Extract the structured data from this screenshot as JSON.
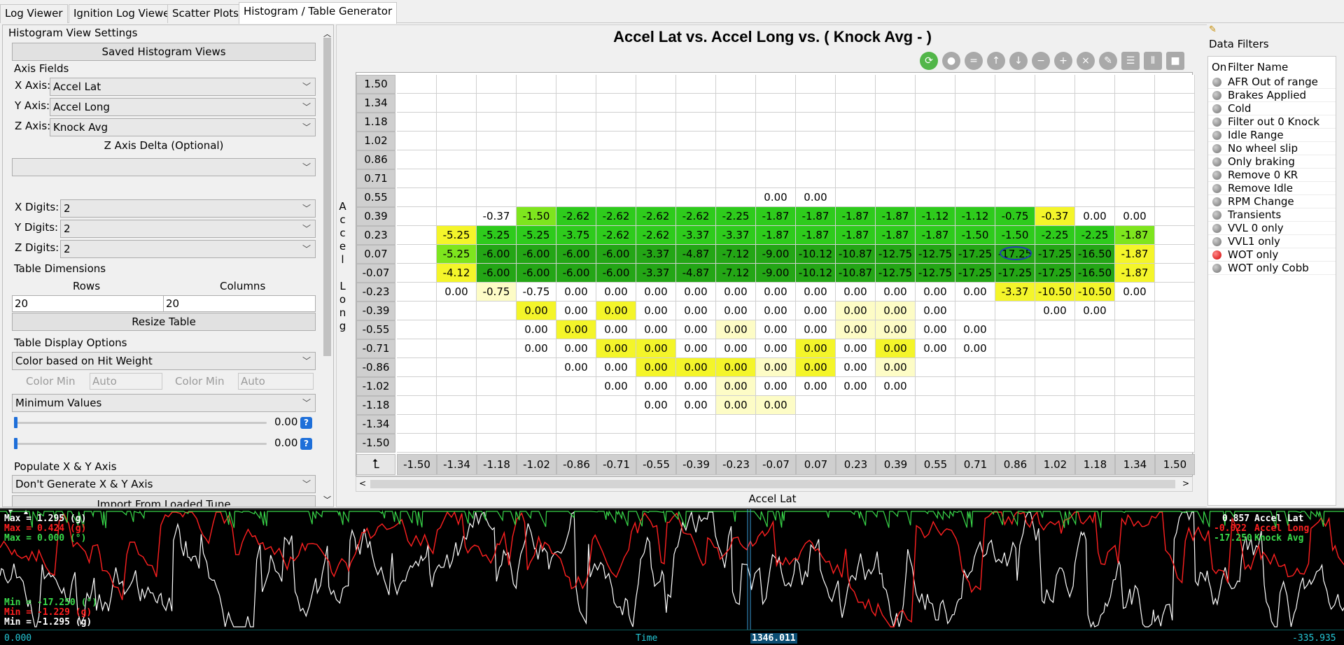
{
  "tabs": [
    {
      "label": "Log Viewer",
      "active": false
    },
    {
      "label": "Ignition Log Viewer",
      "active": false
    },
    {
      "label": "Scatter Plots",
      "active": false
    },
    {
      "label": "Histogram / Table Generator",
      "active": true
    }
  ],
  "settings": {
    "panel_title": "Histogram View Settings",
    "saved_views_button": "Saved Histogram Views",
    "axis_fields_title": "Axis Fields",
    "x_axis_label": "X Axis:",
    "x_axis_value": "Accel Lat",
    "y_axis_label": "Y Axis:",
    "y_axis_value": "Accel Long",
    "z_axis_label": "Z Axis:",
    "z_axis_value": "Knock Avg",
    "z_delta_label": "Z Axis Delta (Optional)",
    "z_delta_value": "",
    "x_digits_label": "X Digits:",
    "x_digits_value": "2",
    "y_digits_label": "Y Digits:",
    "y_digits_value": "2",
    "z_digits_label": "Z Digits:",
    "z_digits_value": "2",
    "table_dims_title": "Table Dimensions",
    "rows_label": "Rows",
    "rows_value": "20",
    "columns_label": "Columns",
    "columns_value": "20",
    "resize_button": "Resize Table",
    "display_options_title": "Table Display Options",
    "color_mode": "Color based on Hit Weight",
    "color_min_label_1": "Color Min",
    "color_min_value_1": "Auto",
    "color_min_label_2": "Color Min",
    "color_min_value_2": "Auto",
    "value_mode": "Minimum Values",
    "slider1_value": "0.00",
    "slider2_value": "0.00",
    "help_glyph": "?",
    "populate_title": "Populate X & Y Axis",
    "populate_value": "Don't Generate X & Y Axis",
    "import_button": "Import From Loaded Tune"
  },
  "table": {
    "title": "Accel Lat vs. Accel Long vs. ( Knock Avg -   )",
    "y_axis_title": "Accel Long",
    "x_axis_title": "Accel Lat",
    "corner_glyph": "⮤",
    "x_headers": [
      "-1.50",
      "-1.34",
      "-1.18",
      "-1.02",
      "-0.86",
      "-0.71",
      "-0.55",
      "-0.39",
      "-0.23",
      "-0.07",
      "0.07",
      "0.23",
      "0.39",
      "0.55",
      "0.71",
      "0.86",
      "1.02",
      "1.18",
      "1.34",
      "1.50"
    ],
    "y_headers": [
      "1.50",
      "1.34",
      "1.18",
      "1.02",
      "0.86",
      "0.71",
      "0.55",
      "0.39",
      "0.23",
      "0.07",
      "-0.07",
      "-0.23",
      "-0.39",
      "-0.55",
      "-0.71",
      "-0.86",
      "-1.02",
      "-1.18",
      "-1.34",
      "-1.50"
    ],
    "rows": [
      [
        "",
        "",
        "",
        "",
        "",
        "",
        "",
        "",
        "",
        "",
        "",
        "",
        "",
        "",
        "",
        "",
        "",
        "",
        "",
        ""
      ],
      [
        "",
        "",
        "",
        "",
        "",
        "",
        "",
        "",
        "",
        "",
        "",
        "",
        "",
        "",
        "",
        "",
        "",
        "",
        "",
        ""
      ],
      [
        "",
        "",
        "",
        "",
        "",
        "",
        "",
        "",
        "",
        "",
        "",
        "",
        "",
        "",
        "",
        "",
        "",
        "",
        "",
        ""
      ],
      [
        "",
        "",
        "",
        "",
        "",
        "",
        "",
        "",
        "",
        "",
        "",
        "",
        "",
        "",
        "",
        "",
        "",
        "",
        "",
        ""
      ],
      [
        "",
        "",
        "",
        "",
        "",
        "",
        "",
        "",
        "",
        "",
        "",
        "",
        "",
        "",
        "",
        "",
        "",
        "",
        "",
        ""
      ],
      [
        "",
        "",
        "",
        "",
        "",
        "",
        "",
        "",
        "",
        "",
        "",
        "",
        "",
        "",
        "",
        "",
        "",
        "",
        "",
        ""
      ],
      [
        "",
        "",
        "",
        "",
        "",
        "",
        "",
        "",
        "",
        "0.00",
        "0.00",
        "",
        "",
        "",
        "",
        "",
        "",
        "",
        "",
        ""
      ],
      [
        "",
        "",
        "-0.37",
        "-1.50",
        "-2.62",
        "-2.62",
        "-2.62",
        "-2.62",
        "-2.25",
        "-1.87",
        "-1.87",
        "-1.87",
        "-1.87",
        "-1.12",
        "-1.12",
        "-0.75",
        "-0.37",
        "0.00",
        "0.00",
        ""
      ],
      [
        "",
        "-5.25",
        "-5.25",
        "-5.25",
        "-3.75",
        "-2.62",
        "-2.62",
        "-3.37",
        "-3.37",
        "-1.87",
        "-1.87",
        "-1.87",
        "-1.87",
        "-1.87",
        "-1.50",
        "-1.50",
        "-2.25",
        "-2.25",
        "-1.87",
        ""
      ],
      [
        "",
        "-5.25",
        "-6.00",
        "-6.00",
        "-6.00",
        "-6.00",
        "-3.37",
        "-4.87",
        "-7.12",
        "-9.00",
        "-10.12",
        "-10.87",
        "-12.75",
        "-12.75",
        "-17.25",
        "-17.25",
        "-17.25",
        "-16.50",
        "-1.87",
        ""
      ],
      [
        "",
        "-4.12",
        "-6.00",
        "-6.00",
        "-6.00",
        "-6.00",
        "-3.37",
        "-4.87",
        "-7.12",
        "-9.00",
        "-10.12",
        "-10.87",
        "-12.75",
        "-12.75",
        "-17.25",
        "-17.25",
        "-17.25",
        "-16.50",
        "-1.87",
        ""
      ],
      [
        "",
        "0.00",
        "-0.75",
        "-0.75",
        "0.00",
        "0.00",
        "0.00",
        "0.00",
        "0.00",
        "0.00",
        "0.00",
        "0.00",
        "0.00",
        "0.00",
        "0.00",
        "-3.37",
        "-10.50",
        "-10.50",
        "0.00",
        ""
      ],
      [
        "",
        "",
        "",
        "0.00",
        "0.00",
        "0.00",
        "0.00",
        "0.00",
        "0.00",
        "0.00",
        "0.00",
        "0.00",
        "0.00",
        "0.00",
        "",
        "",
        "0.00",
        "0.00",
        "",
        ""
      ],
      [
        "",
        "",
        "",
        "0.00",
        "0.00",
        "0.00",
        "0.00",
        "0.00",
        "0.00",
        "0.00",
        "0.00",
        "0.00",
        "0.00",
        "0.00",
        "0.00",
        "",
        "",
        "",
        "",
        ""
      ],
      [
        "",
        "",
        "",
        "0.00",
        "0.00",
        "0.00",
        "0.00",
        "0.00",
        "0.00",
        "0.00",
        "0.00",
        "0.00",
        "0.00",
        "0.00",
        "0.00",
        "",
        "",
        "",
        "",
        ""
      ],
      [
        "",
        "",
        "",
        "",
        "0.00",
        "0.00",
        "0.00",
        "0.00",
        "0.00",
        "0.00",
        "0.00",
        "0.00",
        "0.00",
        "",
        "",
        "",
        "",
        "",
        "",
        ""
      ],
      [
        "",
        "",
        "",
        "",
        "",
        "0.00",
        "0.00",
        "0.00",
        "0.00",
        "0.00",
        "0.00",
        "0.00",
        "0.00",
        "",
        "",
        "",
        "",
        "",
        "",
        ""
      ],
      [
        "",
        "",
        "",
        "",
        "",
        "",
        "0.00",
        "0.00",
        "0.00",
        "0.00",
        "",
        "",
        "",
        "",
        "",
        "",
        "",
        "",
        "",
        ""
      ],
      [
        "",
        "",
        "",
        "",
        "",
        "",
        "",
        "",
        "",
        "",
        "",
        "",
        "",
        "",
        "",
        "",
        "",
        "",
        "",
        ""
      ],
      [
        "",
        "",
        "",
        "",
        "",
        "",
        "",
        "",
        "",
        "",
        "",
        "",
        "",
        "",
        "",
        "",
        "",
        "",
        "",
        ""
      ]
    ],
    "colors": [
      "....................",
      "....................",
      "....................",
      "....................",
      "....................",
      "....................",
      ".........ww.........",
      "..wlGGGGGGGGGGGGyw..",
      ".yGGGGGGGGGGGGGGGGl.",
      ".lDDDDDDDDDDDDDDDDy.",
      ".yDDDDDDDDDDDDDDDDy.",
      ".wpwwwwwwwwwwwwyyyw.",
      "...ywywwwwwppw..ww..",
      "...wywwwpwwppww.....",
      "...wwyywwwywyww.....",
      "....wwyyypywp.......",
      ".....wwwpwww........",
      "......wwpp..........",
      "....................",
      "...................."
    ],
    "palette": {
      "w": "#ffffff",
      "p": "#fdfcc6",
      "y": "#f4f52a",
      "l": "#7ee51e",
      "G": "#2ecb1c",
      "D": "#24a616"
    }
  },
  "toolbar": [
    {
      "name": "refresh-tool-icon",
      "glyph": "⟳",
      "active": true,
      "square": false
    },
    {
      "name": "record-tool-icon",
      "glyph": "●",
      "active": false,
      "square": false
    },
    {
      "name": "equal-tool-icon",
      "glyph": "=",
      "active": false,
      "square": false
    },
    {
      "name": "up-tool-icon",
      "glyph": "↑",
      "active": false,
      "square": false
    },
    {
      "name": "down-tool-icon",
      "glyph": "↓",
      "active": false,
      "square": false
    },
    {
      "name": "minus-tool-icon",
      "glyph": "−",
      "active": false,
      "square": false
    },
    {
      "name": "plus-tool-icon",
      "glyph": "+",
      "active": false,
      "square": false
    },
    {
      "name": "close-tool-icon",
      "glyph": "×",
      "active": false,
      "square": false
    },
    {
      "name": "pencil-tool-icon",
      "glyph": "✎",
      "active": false,
      "square": false
    },
    {
      "name": "rows-tool-icon",
      "glyph": "☰",
      "active": false,
      "square": true
    },
    {
      "name": "columns-tool-icon",
      "glyph": "⦀",
      "active": false,
      "square": true
    },
    {
      "name": "block-tool-icon",
      "glyph": "■",
      "active": false,
      "square": true
    }
  ],
  "filters": {
    "title": "Data Filters",
    "col_on": "On",
    "col_name": "Filter Name",
    "items": [
      {
        "name": "AFR Out of range",
        "on": false
      },
      {
        "name": "Brakes Applied",
        "on": false
      },
      {
        "name": "Cold",
        "on": false
      },
      {
        "name": "Filter out 0 Knock",
        "on": false
      },
      {
        "name": "Idle Range",
        "on": false
      },
      {
        "name": "No wheel slip",
        "on": false
      },
      {
        "name": "Only braking",
        "on": false
      },
      {
        "name": "Remove 0 KR",
        "on": false
      },
      {
        "name": "Remove Idle",
        "on": false
      },
      {
        "name": "RPM Change",
        "on": false
      },
      {
        "name": "Transients",
        "on": false
      },
      {
        "name": "VVL 0 only",
        "on": false
      },
      {
        "name": "VVL1 only",
        "on": false
      },
      {
        "name": "WOT only",
        "on": true
      },
      {
        "name": "WOT only Cobb",
        "on": false
      }
    ]
  },
  "graph": {
    "max_lat": "Max = 1.295 (g)",
    "max_long": "Max = 0.424 (g)",
    "max_knock": "Max = 0.000 (°)",
    "min_knock": "Min = -17.250 (°)",
    "min_long": "Min = -1.229 (g)",
    "min_lat": "Min = -1.295 (g)",
    "cur_lat_val": "0.857",
    "cur_lat_name": "Accel Lat",
    "cur_long_val": "-0.022",
    "cur_long_name": "Accel Long",
    "cur_knock_val": "-17.250",
    "cur_knock_name": "Knock Avg",
    "time_start": "0.000",
    "time_label": "Time",
    "time_cursor": "1346.011",
    "time_end": "-335.935",
    "colors": {
      "lat": "#ffffff",
      "long": "#ff2020",
      "knock": "#39d94a",
      "time": "#25c7d6"
    }
  }
}
